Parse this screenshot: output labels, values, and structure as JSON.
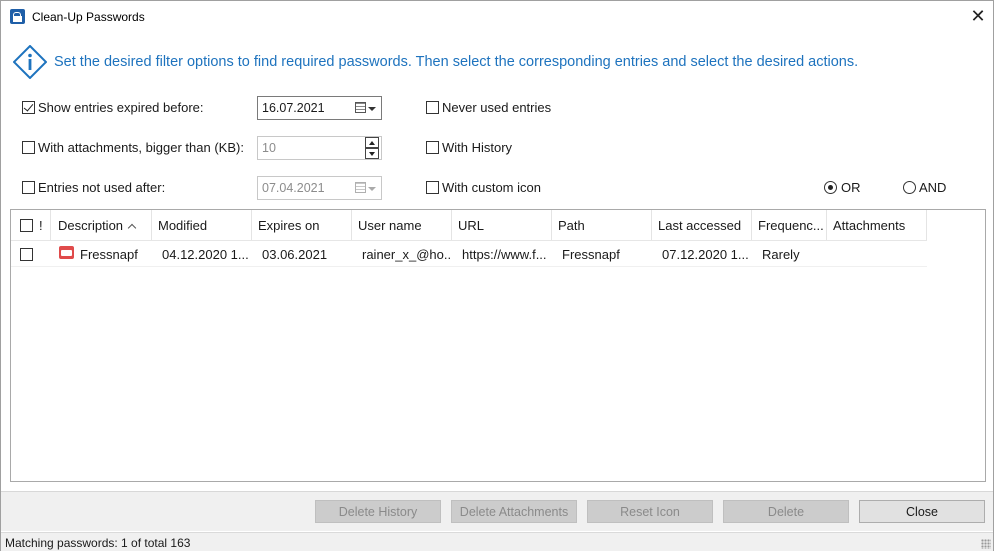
{
  "window": {
    "title": "Clean-Up Passwords",
    "close_glyph": "✕"
  },
  "info": {
    "text": "Set the desired filter options to find required passwords. Then select the corresponding entries and select the desired actions."
  },
  "filters": {
    "expired_before": {
      "label": "Show entries expired before:",
      "checked": true,
      "value": "16.07.2021"
    },
    "attachments_bigger": {
      "label": "With attachments, bigger than (KB):",
      "checked": false,
      "value": "10"
    },
    "not_used_after": {
      "label": "Entries not used after:",
      "checked": false,
      "value": "07.04.2021"
    },
    "never_used": {
      "label": "Never used entries",
      "checked": false
    },
    "with_history": {
      "label": "With History",
      "checked": false
    },
    "custom_icon": {
      "label": "With custom icon",
      "checked": false
    },
    "logic": {
      "or_label": "OR",
      "and_label": "AND",
      "selected": "OR"
    }
  },
  "table": {
    "columns": [
      "!",
      "Description",
      "Modified",
      "Expires on",
      "User name",
      "URL",
      "Path",
      "Last accessed",
      "Frequenc...",
      "Attachments"
    ],
    "rows": [
      {
        "description": "Fressnapf",
        "modified": "04.12.2020 1...",
        "expires": "03.06.2021",
        "user": "rainer_x_@ho...",
        "url": "https://www.f...",
        "path": "Fressnapf",
        "last_accessed": "07.12.2020 1...",
        "frequency": "Rarely",
        "attachments": ""
      }
    ]
  },
  "buttons": {
    "delete_history": "Delete History",
    "delete_attachments": "Delete Attachments",
    "reset_icon": "Reset Icon",
    "delete": "Delete",
    "close": "Close"
  },
  "status": {
    "text": "Matching passwords: 1 of total 163"
  },
  "colors": {
    "accent": "#1e73be",
    "disabled_button": "#cccccc"
  }
}
